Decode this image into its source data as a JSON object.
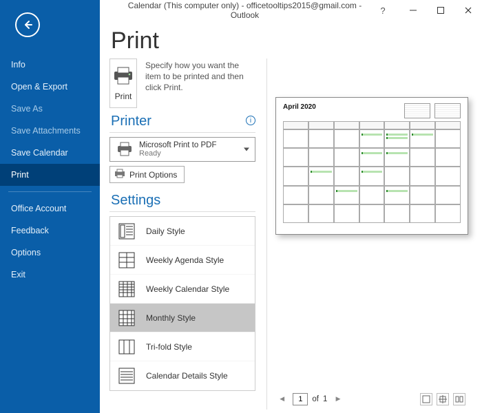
{
  "window": {
    "title": "Calendar (This computer only) - officetooltips2015@gmail.com  -  Outlook"
  },
  "page_heading": "Print",
  "sidebar": {
    "items": [
      {
        "label": "Info",
        "dim": false
      },
      {
        "label": "Open & Export",
        "dim": false
      },
      {
        "label": "Save As",
        "dim": true
      },
      {
        "label": "Save Attachments",
        "dim": true
      },
      {
        "label": "Save Calendar",
        "dim": false
      },
      {
        "label": "Print",
        "dim": false,
        "selected": true
      }
    ],
    "items2": [
      {
        "label": "Office Account"
      },
      {
        "label": "Feedback"
      },
      {
        "label": "Options"
      },
      {
        "label": "Exit"
      }
    ]
  },
  "print": {
    "button_label": "Print",
    "description": "Specify how you want the item to be printed and then click Print."
  },
  "printer": {
    "heading": "Printer",
    "name": "Microsoft Print to PDF",
    "status": "Ready",
    "options_label": "Print Options"
  },
  "settings": {
    "heading": "Settings",
    "styles": [
      {
        "label": "Daily Style"
      },
      {
        "label": "Weekly Agenda Style"
      },
      {
        "label": "Weekly Calendar Style"
      },
      {
        "label": "Monthly Style",
        "selected": true
      },
      {
        "label": "Tri-fold Style"
      },
      {
        "label": "Calendar Details Style"
      }
    ]
  },
  "preview": {
    "month_label": "April 2020"
  },
  "pager": {
    "current": "1",
    "of_label": "of",
    "total": "1"
  }
}
